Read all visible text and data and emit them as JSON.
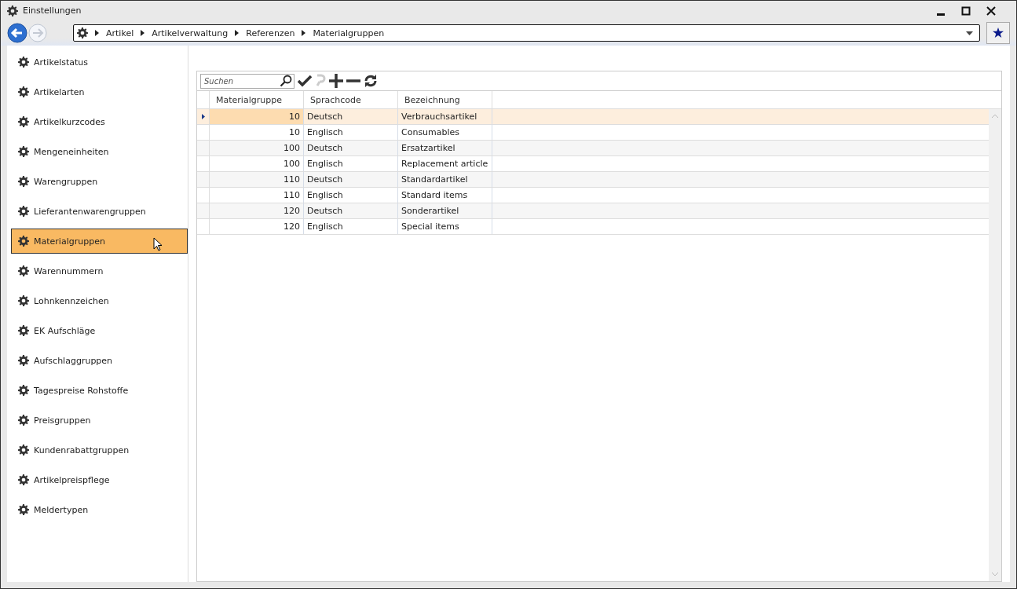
{
  "window": {
    "title": "Einstellungen"
  },
  "breadcrumb": [
    "Artikel",
    "Artikelverwaltung",
    "Referenzen",
    "Materialgruppen"
  ],
  "sidebar": {
    "items": [
      {
        "label": "Artikelstatus",
        "selected": false
      },
      {
        "label": "Artikelarten",
        "selected": false
      },
      {
        "label": "Artikelkurzcodes",
        "selected": false
      },
      {
        "label": "Mengeneinheiten",
        "selected": false
      },
      {
        "label": "Warengruppen",
        "selected": false
      },
      {
        "label": "Lieferantenwarengruppen",
        "selected": false
      },
      {
        "label": "Materialgruppen",
        "selected": true
      },
      {
        "label": "Warennummern",
        "selected": false
      },
      {
        "label": "Lohnkennzeichen",
        "selected": false
      },
      {
        "label": "EK Aufschläge",
        "selected": false
      },
      {
        "label": "Aufschlaggruppen",
        "selected": false
      },
      {
        "label": "Tagespreise Rohstoffe",
        "selected": false
      },
      {
        "label": "Preisgruppen",
        "selected": false
      },
      {
        "label": "Kundenrabattgruppen",
        "selected": false
      },
      {
        "label": "Artikelpreispflege",
        "selected": false
      },
      {
        "label": "Meldertypen",
        "selected": false
      }
    ]
  },
  "search": {
    "placeholder": "Suchen"
  },
  "table": {
    "columns": [
      "Materialgruppe",
      "Sprachcode",
      "Bezeichnung"
    ],
    "rows": [
      {
        "cells": [
          "10",
          "Deutsch",
          "Verbrauchsartikel"
        ],
        "selected": true
      },
      {
        "cells": [
          "10",
          "Englisch",
          "Consumables"
        ],
        "selected": false
      },
      {
        "cells": [
          "100",
          "Deutsch",
          "Ersatzartikel"
        ],
        "selected": false
      },
      {
        "cells": [
          "100",
          "Englisch",
          "Replacement article"
        ],
        "selected": false
      },
      {
        "cells": [
          "110",
          "Deutsch",
          "Standardartikel"
        ],
        "selected": false
      },
      {
        "cells": [
          "110",
          "Englisch",
          "Standard items"
        ],
        "selected": false
      },
      {
        "cells": [
          "120",
          "Deutsch",
          "Sonderartikel"
        ],
        "selected": false
      },
      {
        "cells": [
          "120",
          "Englisch",
          "Special items"
        ],
        "selected": false
      }
    ]
  }
}
